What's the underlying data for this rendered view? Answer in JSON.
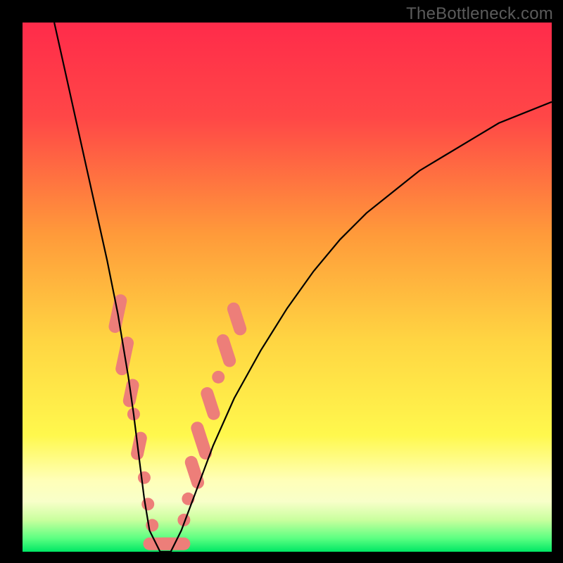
{
  "watermark": "TheBottleneck.com",
  "chart_data": {
    "type": "line",
    "title": "",
    "xlabel": "",
    "ylabel": "",
    "xlim": [
      0,
      100
    ],
    "ylim": [
      0,
      100
    ],
    "gradient_stops": [
      {
        "offset": 0.0,
        "color": "#ff2b4a"
      },
      {
        "offset": 0.18,
        "color": "#ff4747"
      },
      {
        "offset": 0.4,
        "color": "#ff9a3a"
      },
      {
        "offset": 0.6,
        "color": "#ffd542"
      },
      {
        "offset": 0.78,
        "color": "#fff84d"
      },
      {
        "offset": 0.865,
        "color": "#ffffb8"
      },
      {
        "offset": 0.905,
        "color": "#f8ffc9"
      },
      {
        "offset": 0.94,
        "color": "#c9ff9e"
      },
      {
        "offset": 0.975,
        "color": "#5bff81"
      },
      {
        "offset": 1.0,
        "color": "#00e765"
      }
    ],
    "series": [
      {
        "name": "bottleneck-curve",
        "x": [
          6,
          8,
          10,
          12,
          14,
          16,
          18,
          19,
          20,
          21,
          22,
          23,
          24,
          26,
          28,
          30,
          33,
          36,
          40,
          45,
          50,
          55,
          60,
          65,
          70,
          75,
          80,
          85,
          90,
          95,
          100
        ],
        "y": [
          100,
          91,
          82,
          73,
          64,
          55,
          45,
          39,
          33,
          26,
          18,
          10,
          4,
          0,
          0,
          4,
          12,
          20,
          29,
          38,
          46,
          53,
          59,
          64,
          68,
          72,
          75,
          78,
          81,
          83,
          85
        ]
      }
    ],
    "markers": {
      "name": "highlighted-points",
      "color": "#ed7e79",
      "points": [
        {
          "x": 18.0,
          "y": 45,
          "shape": "pill",
          "len": 5
        },
        {
          "x": 19.3,
          "y": 37,
          "shape": "pill",
          "len": 5
        },
        {
          "x": 20.5,
          "y": 30,
          "shape": "pill",
          "len": 3
        },
        {
          "x": 21.0,
          "y": 26,
          "shape": "dot"
        },
        {
          "x": 22.0,
          "y": 20,
          "shape": "pill",
          "len": 3
        },
        {
          "x": 23.0,
          "y": 14,
          "shape": "dot"
        },
        {
          "x": 23.7,
          "y": 9,
          "shape": "dot"
        },
        {
          "x": 24.5,
          "y": 5,
          "shape": "dot"
        },
        {
          "x": 26.0,
          "y": 1.5,
          "shape": "pill-h",
          "len": 4
        },
        {
          "x": 28.5,
          "y": 1.5,
          "shape": "pill-h",
          "len": 4
        },
        {
          "x": 30.5,
          "y": 6,
          "shape": "dot"
        },
        {
          "x": 31.3,
          "y": 10,
          "shape": "dot"
        },
        {
          "x": 32.5,
          "y": 15,
          "shape": "pill",
          "len": 4
        },
        {
          "x": 33.8,
          "y": 21,
          "shape": "pill",
          "len": 5
        },
        {
          "x": 35.5,
          "y": 28,
          "shape": "pill",
          "len": 4
        },
        {
          "x": 37.0,
          "y": 33,
          "shape": "dot"
        },
        {
          "x": 38.5,
          "y": 38,
          "shape": "pill",
          "len": 4
        },
        {
          "x": 40.5,
          "y": 44,
          "shape": "pill",
          "len": 4
        }
      ]
    }
  }
}
